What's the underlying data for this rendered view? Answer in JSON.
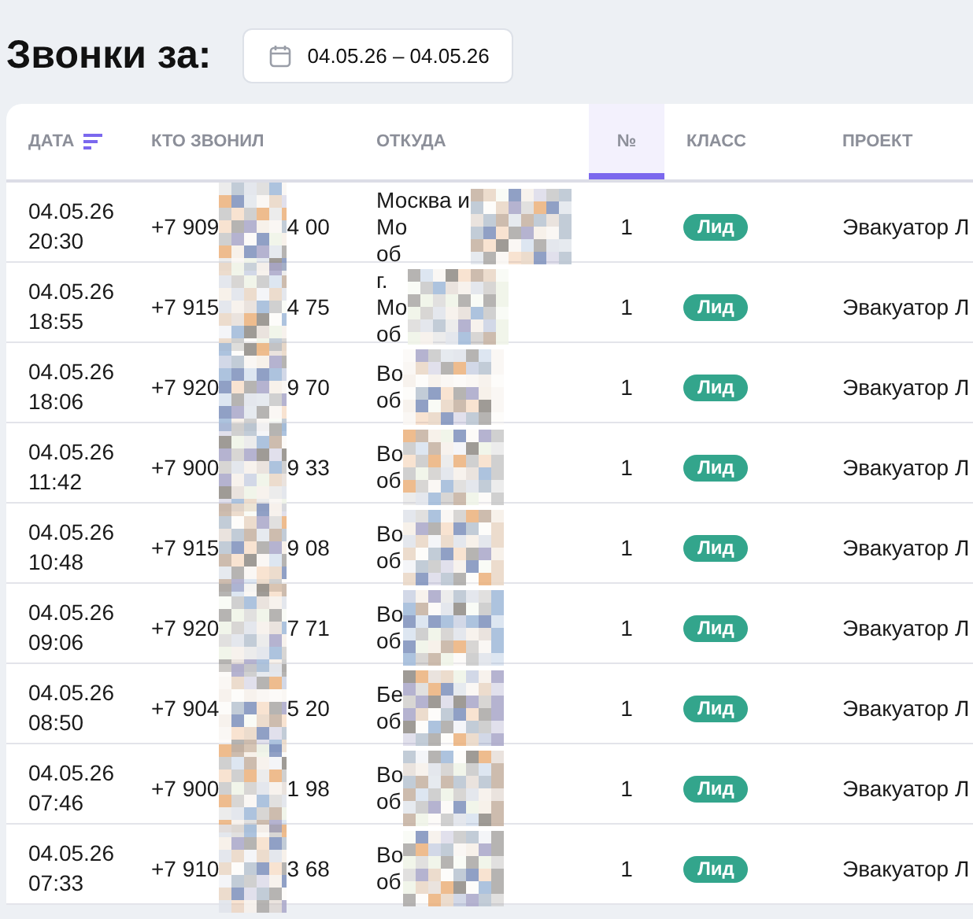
{
  "title": "Звонки за:",
  "date_range": "04.05.26 – 04.05.26",
  "table": {
    "columns": [
      {
        "label": "ДАТА",
        "sorted": true,
        "selected": false
      },
      {
        "label": "КТО ЗВОНИЛ",
        "sorted": false,
        "selected": false
      },
      {
        "label": "ОТКУДА",
        "sorted": false,
        "selected": false
      },
      {
        "label": "№",
        "sorted": false,
        "selected": true
      },
      {
        "label": "КЛАСС",
        "sorted": false,
        "selected": false
      },
      {
        "label": "ПРОЕКТ",
        "sorted": false,
        "selected": false
      }
    ],
    "rows": [
      {
        "date": "04.05.26",
        "time": "20:30",
        "phone_start": "+7 909",
        "phone_end": "4 00",
        "origin": [
          "Москва и",
          "Мо",
          "об"
        ],
        "number": "1",
        "class": "Лид",
        "project": "Эвакуатор Л"
      },
      {
        "date": "04.05.26",
        "time": "18:55",
        "phone_start": "+7 915",
        "phone_end": "4 75",
        "origin": [
          "г.",
          "Мо",
          "об"
        ],
        "number": "1",
        "class": "Лид",
        "project": "Эвакуатор Л"
      },
      {
        "date": "04.05.26",
        "time": "18:06",
        "phone_start": "+7 920",
        "phone_end": "9 70",
        "origin": [
          "Во",
          "об"
        ],
        "number": "1",
        "class": "Лид",
        "project": "Эвакуатор Л"
      },
      {
        "date": "04.05.26",
        "time": "11:42",
        "phone_start": "+7 900",
        "phone_end": "9 33",
        "origin": [
          "Во",
          "об"
        ],
        "number": "1",
        "class": "Лид",
        "project": "Эвакуатор Л"
      },
      {
        "date": "04.05.26",
        "time": "10:48",
        "phone_start": "+7 915",
        "phone_end": "9 08",
        "origin": [
          "Во",
          "об"
        ],
        "number": "1",
        "class": "Лид",
        "project": "Эвакуатор Л"
      },
      {
        "date": "04.05.26",
        "time": "09:06",
        "phone_start": "+7 920",
        "phone_end": "7 71",
        "origin": [
          "Во",
          "об"
        ],
        "number": "1",
        "class": "Лид",
        "project": "Эвакуатор Л"
      },
      {
        "date": "04.05.26",
        "time": "08:50",
        "phone_start": "+7 904",
        "phone_end": "5 20",
        "origin": [
          "Бе",
          "об"
        ],
        "number": "1",
        "class": "Лид",
        "project": "Эвакуатор Л"
      },
      {
        "date": "04.05.26",
        "time": "07:46",
        "phone_start": "+7 900",
        "phone_end": "1 98",
        "origin": [
          "Во",
          "об"
        ],
        "number": "1",
        "class": "Лид",
        "project": "Эвакуатор Л"
      },
      {
        "date": "04.05.26",
        "time": "07:33",
        "phone_start": "+7 910",
        "phone_end": "3 68",
        "origin": [
          "Во",
          "об"
        ],
        "number": "1",
        "class": "Лид",
        "project": "Эвакуатор Л"
      }
    ]
  }
}
